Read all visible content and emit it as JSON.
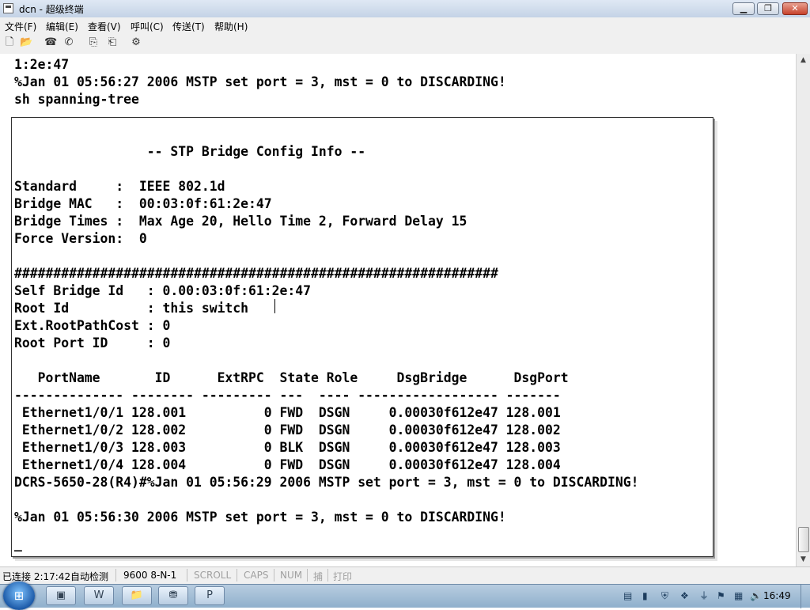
{
  "window": {
    "title": "dcn - 超级终端"
  },
  "menu": [
    "文件(F)",
    "编辑(E)",
    "查看(V)",
    "呼叫(C)",
    "传送(T)",
    "帮助(H)"
  ],
  "toolbar": {
    "icons": [
      "new-file-icon",
      "open-folder-icon",
      "phone-icon",
      "disconnect-icon",
      "send-icon",
      "receive-icon",
      "properties-icon"
    ]
  },
  "terminal": {
    "lines": [
      "1:2e:47",
      "%Jan 01 05:56:27 2006 MSTP set port = 3, mst = 0 to DISCARDING!",
      "sh spanning-tree",
      "",
      "",
      "                 -- STP Bridge Config Info --",
      "",
      "Standard     :  IEEE 802.1d",
      "Bridge MAC   :  00:03:0f:61:2e:47",
      "Bridge Times :  Max Age 20, Hello Time 2, Forward Delay 15",
      "Force Version:  0",
      "",
      "##############################################################",
      "Self Bridge Id   : 0.00:03:0f:61:2e:47",
      "Root Id          : this switch",
      "Ext.RootPathCost : 0",
      "Root Port ID     : 0",
      "",
      "   PortName       ID      ExtRPC  State Role     DsgBridge      DsgPort",
      "-------------- -------- --------- ---  ---- ------------------ -------",
      " Ethernet1/0/1 128.001          0 FWD  DSGN     0.00030f612e47 128.001",
      " Ethernet1/0/2 128.002          0 FWD  DSGN     0.00030f612e47 128.002",
      " Ethernet1/0/3 128.003          0 BLK  DSGN     0.00030f612e47 128.003",
      " Ethernet1/0/4 128.004          0 FWD  DSGN     0.00030f612e47 128.004",
      "DCRS-5650-28(R4)#%Jan 01 05:56:29 2006 MSTP set port = 3, mst = 0 to DISCARDING!",
      "",
      "%Jan 01 05:56:30 2006 MSTP set port = 3, mst = 0 to DISCARDING!",
      "",
      "_"
    ]
  },
  "statusbar": {
    "connected": "已连接 2:17:42",
    "detect": "自动检测",
    "baud": "9600 8-N-1",
    "scroll": "SCROLL",
    "caps": "CAPS",
    "num": "NUM",
    "capture": "捕",
    "print": "打印"
  },
  "taskbar": {
    "clock": "16:49",
    "apps": [
      "explorer-icon",
      "word-icon",
      "folder-icon",
      "network-icon",
      "powerpoint-icon"
    ]
  }
}
